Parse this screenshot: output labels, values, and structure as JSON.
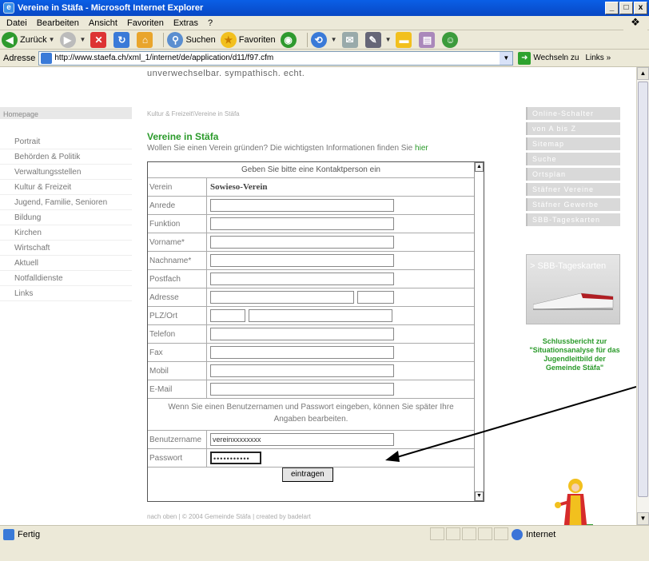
{
  "window": {
    "title": "Vereine in Stäfa - Microsoft Internet Explorer",
    "controls": [
      "_",
      "□",
      "x"
    ]
  },
  "menu": [
    "Datei",
    "Bearbeiten",
    "Ansicht",
    "Favoriten",
    "Extras",
    "?"
  ],
  "toolbar": {
    "back": "Zurück",
    "search": "Suchen",
    "favorites": "Favoriten"
  },
  "address": {
    "label": "Adresse",
    "url": "http://www.staefa.ch/xml_1/internet/de/application/d11/f97.cfm",
    "go": "Wechseln zu",
    "links": "Links"
  },
  "page": {
    "slogan": "unverwechselbar. sympathisch. echt.",
    "home_label": "Homepage",
    "breadcrumb": "Kultur & Freizeit\\Vereine in Stäfa",
    "title": "Vereine in Stäfa",
    "subtitle": "Wollen Sie einen Verein gründen? Die wichtigsten Informationen finden Sie",
    "subtitle_link": "hier",
    "left_nav": [
      "Portrait",
      "Behörden & Politik",
      "Verwaltungsstellen",
      "Kultur & Freizeit",
      "Jugend, Familie, Senioren",
      "Bildung",
      "Kirchen",
      "Wirtschaft",
      "Aktuell",
      "Notfalldienste",
      "Links"
    ],
    "right_nav": [
      "Online-Schalter",
      "von A bis Z",
      "Sitemap",
      "Suche",
      "Ortsplan",
      "Stäfner Vereine",
      "Stäfner Gewerbe",
      "SBB-Tageskarten"
    ],
    "sbb_banner": "> SBB-Tageskarten",
    "report_link": "Schlussbericht zur \"Situationsanalyse für das Jugendleitbild der Gemeinde Stäfa\"",
    "footer": "nach oben | © 2004 Gemeinde Stäfa | created by badelart"
  },
  "form": {
    "header": "Geben Sie bitte eine Kontaktperson ein",
    "verein_label": "Verein",
    "verein_value": "Sowieso-Verein",
    "fields": {
      "anrede": "Anrede",
      "funktion": "Funktion",
      "vorname": "Vorname*",
      "nachname": "Nachname*",
      "postfach": "Postfach",
      "adresse": "Adresse",
      "plzort": "PLZ/Ort",
      "telefon": "Telefon",
      "fax": "Fax",
      "mobil": "Mobil",
      "email": "E-Mail"
    },
    "info": "Wenn Sie einen Benutzernamen und Passwort eingeben, können Sie später Ihre Angaben bearbeiten.",
    "username_label": "Benutzername",
    "username_value": "vereinxxxxxxxx",
    "password_label": "Passwort",
    "password_value": "•••••••••••",
    "submit": "eintragen"
  },
  "status": {
    "left": "Fertig",
    "zone": "Internet"
  }
}
